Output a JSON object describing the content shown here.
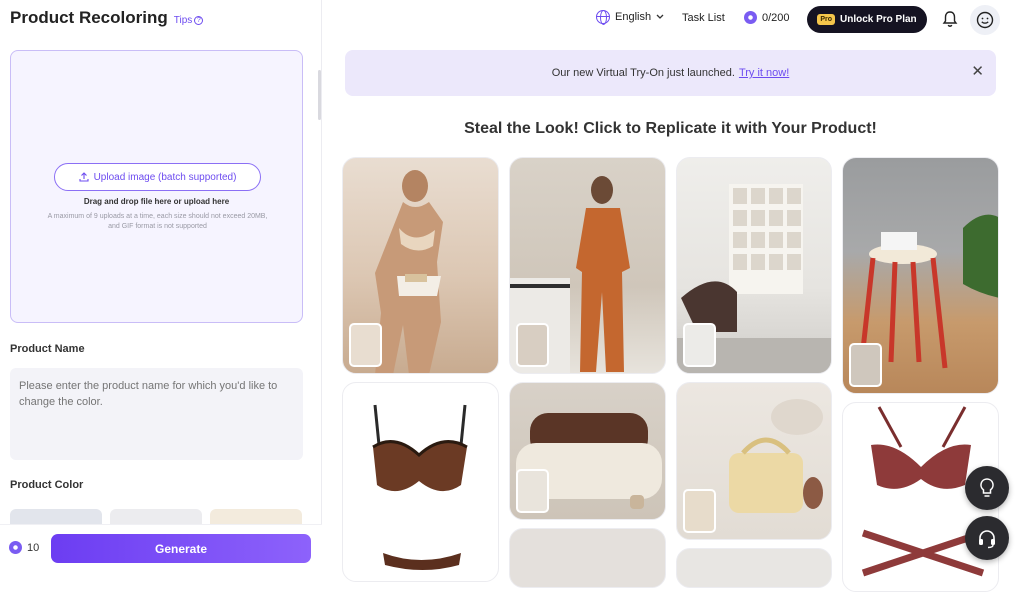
{
  "sidebar": {
    "title": "Product Recoloring",
    "tips_label": "Tips",
    "upload_button_label": "Upload image (batch supported)",
    "drag_text": "Drag and drop file here or upload here",
    "limit_text": "A maximum of 9 uploads at a time, each size should not exceed 20MB, and GIF format is not supported",
    "product_name_label": "Product Name",
    "product_name_placeholder": "Please enter the product name for which you'd like to change the color.",
    "product_color_label": "Product Color",
    "swatches": [
      "#e2e5ec",
      "#ececef",
      "#f3ebdd"
    ],
    "credit_cost": "10",
    "generate_label": "Generate"
  },
  "header": {
    "language": "English",
    "task_list_label": "Task List",
    "credits": "0/200",
    "pro_badge": "Pro",
    "unlock_label": "Unlock Pro Plan"
  },
  "banner": {
    "text": "Our new Virtual Try-On just launched.",
    "link": "Try it now!"
  },
  "gallery": {
    "heading": "Steal the Look! Click to Replicate it with Your Product!",
    "items": [
      {
        "name": "beige-lingerie-model"
      },
      {
        "name": "orange-pajama-model"
      },
      {
        "name": "wall-art-room"
      },
      {
        "name": "red-stool-interior"
      },
      {
        "name": "brown-lace-bra"
      },
      {
        "name": "teddy-armchair"
      },
      {
        "name": "yellow-cosmetic-bag"
      },
      {
        "name": "red-lace-lingerie"
      }
    ]
  },
  "colors": {
    "accent": "#6d4cf0",
    "dark": "#151322",
    "banner_bg": "#ece8fb"
  }
}
